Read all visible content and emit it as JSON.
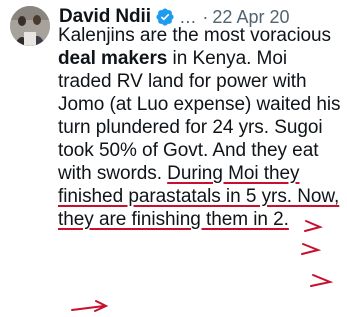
{
  "tweet": {
    "author_name": "David Ndii",
    "verified_icon": "verified-badge-icon",
    "handle_ellipsis": "...",
    "separator": "·",
    "date": "22 Apr 20",
    "more_icon": "more-options-icon",
    "text_part1": "Kalenjins are the most voracious ",
    "text_bold": "deal makers",
    "text_part2": " in Kenya. Moi traded RV land for power with Jomo (at Luo expense) waited his turn plundered for 24 yrs. Sugoi took 50% of Govt. And they eat with swords. ",
    "text_underlined": "During Moi they finished parastatals in 5 yrs. Now, they are finishing them in 2."
  },
  "colors": {
    "verified_blue": "#1d9bf0",
    "annotation_red": "#c8102e",
    "text_primary": "#0f1419",
    "text_secondary": "#536471"
  }
}
